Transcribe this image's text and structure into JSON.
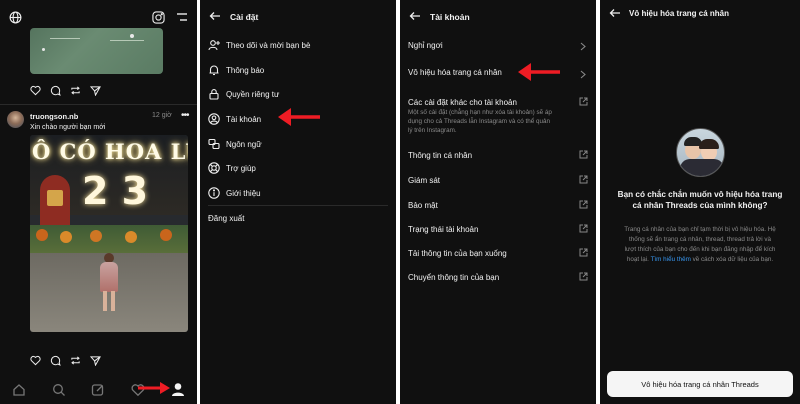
{
  "feed": {
    "author": "truongson.nb",
    "time": "12 giờ",
    "caption": "Xin chào người bạn mới",
    "image_sign_text": "Ô CÓ HOA LU",
    "image_numbers": "2 3",
    "icons": {
      "top_left": "globe-icon",
      "top_right_1": "instagram-icon",
      "top_right_2": "menu-icon",
      "actions": [
        "heart-icon",
        "comment-icon",
        "repost-icon",
        "send-icon"
      ],
      "bottom_nav": [
        "home-icon",
        "search-icon",
        "compose-icon",
        "heart-icon",
        "profile-icon"
      ]
    }
  },
  "settings": {
    "title": "Cài đặt",
    "items": [
      {
        "label": "Theo dõi và mời bạn bè",
        "icon": "add-person-icon"
      },
      {
        "label": "Thông báo",
        "icon": "bell-icon"
      },
      {
        "label": "Quyền riêng tư",
        "icon": "lock-icon"
      },
      {
        "label": "Tài khoản",
        "icon": "account-icon"
      },
      {
        "label": "Ngôn ngữ",
        "icon": "language-icon"
      },
      {
        "label": "Trợ giúp",
        "icon": "help-icon"
      },
      {
        "label": "Giới thiệu",
        "icon": "info-icon"
      }
    ],
    "logout": "Đăng xuất"
  },
  "account": {
    "title": "Tài khoản",
    "items": [
      {
        "label": "Nghỉ ngơi",
        "icon": "chevron-right-icon"
      },
      {
        "label": "Vô hiệu hóa trang cá nhân",
        "icon": "chevron-right-icon"
      },
      {
        "label": "Các cài đặt khác cho tài khoản",
        "icon": "external-link-icon"
      },
      {
        "label": "Thông tin cá nhân",
        "icon": "external-link-icon"
      },
      {
        "label": "Giám sát",
        "icon": "external-link-icon"
      },
      {
        "label": "Bảo mật",
        "icon": "external-link-icon"
      },
      {
        "label": "Trạng thái tài khoản",
        "icon": "external-link-icon"
      },
      {
        "label": "Tải thông tin của bạn xuống",
        "icon": "external-link-icon"
      },
      {
        "label": "Chuyển thông tin của bạn",
        "icon": "external-link-icon"
      }
    ],
    "other_desc_1": "Một số cài đặt (chẳng hạn như xóa tài khoản) sẽ áp",
    "other_desc_2": "dụng cho cả Threads lẫn Instagram và có thể quản",
    "other_desc_3": "lý trên Instagram."
  },
  "deactivate": {
    "title": "Vô hiệu hóa trang cá nhân",
    "question_1": "Bạn có chắc chắn muốn vô hiệu hóa trang",
    "question_2": "cá nhân Threads của mình không?",
    "desc_1": "Trang cá nhân của bạn chỉ tạm thời bị vô hiệu hóa. Hệ",
    "desc_2": "thống sẽ ẩn trang cá nhân, thread, thread trả lời và",
    "desc_3": "lượt thích của bạn cho đến khi bạn đăng nhập để kích",
    "desc_4_before": "hoạt lại. ",
    "desc_link": "Tìm hiểu thêm",
    "desc_4_after": " về cách xóa dữ liệu của bạn.",
    "button": "Vô hiệu hóa trang cá nhân Threads"
  },
  "colors": {
    "background": "#101010",
    "annotation_arrow": "#ee1c24",
    "link": "#3897f0",
    "button_bg": "#f5f5f5"
  }
}
